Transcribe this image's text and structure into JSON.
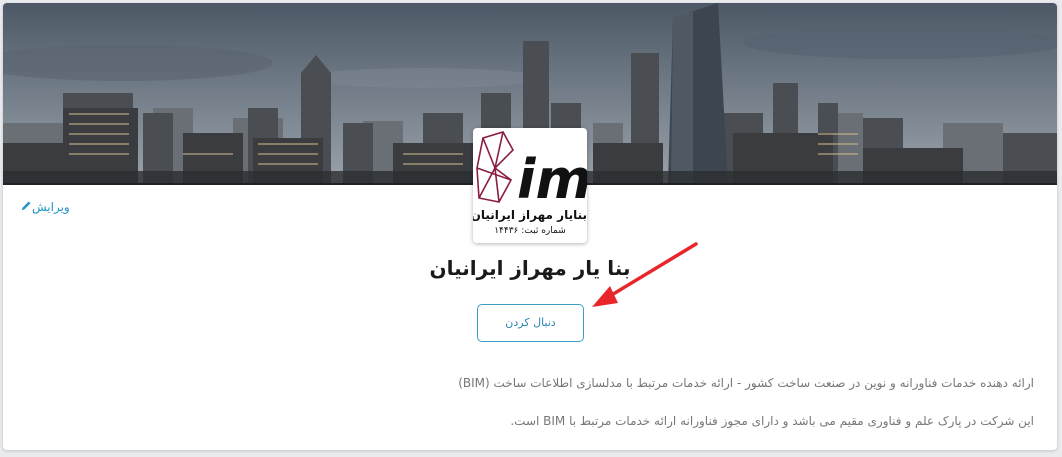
{
  "profile": {
    "edit_label": "ویرایش",
    "company_name": "بنا یار مهراز ایرانیان",
    "follow_label": "دنبال کردن",
    "description_line_1": "ارائه دهنده خدمات فناورانه و نوین در صنعت ساخت کشور - ارائه خدمات مرتبط با مدلسازی اطلاعات ساخت (BIM)",
    "description_line_2": "این شرکت در پارک علم و فناوری مقیم می باشد و دارای مجوز فناورانه ارائه خدمات مرتبط با BIM است."
  },
  "logo": {
    "name_text": "بنایار مهراز ایرانیان",
    "registration_text": "شماره ثبت: ۱۴۴۳۶",
    "brand_text": "im",
    "brand_color": "#8b1d3f"
  },
  "colors": {
    "accent": "#2196c9",
    "annotation_arrow": "#e8262a"
  },
  "icons": {
    "edit": "pencil-icon",
    "annotation": "red-arrow"
  }
}
